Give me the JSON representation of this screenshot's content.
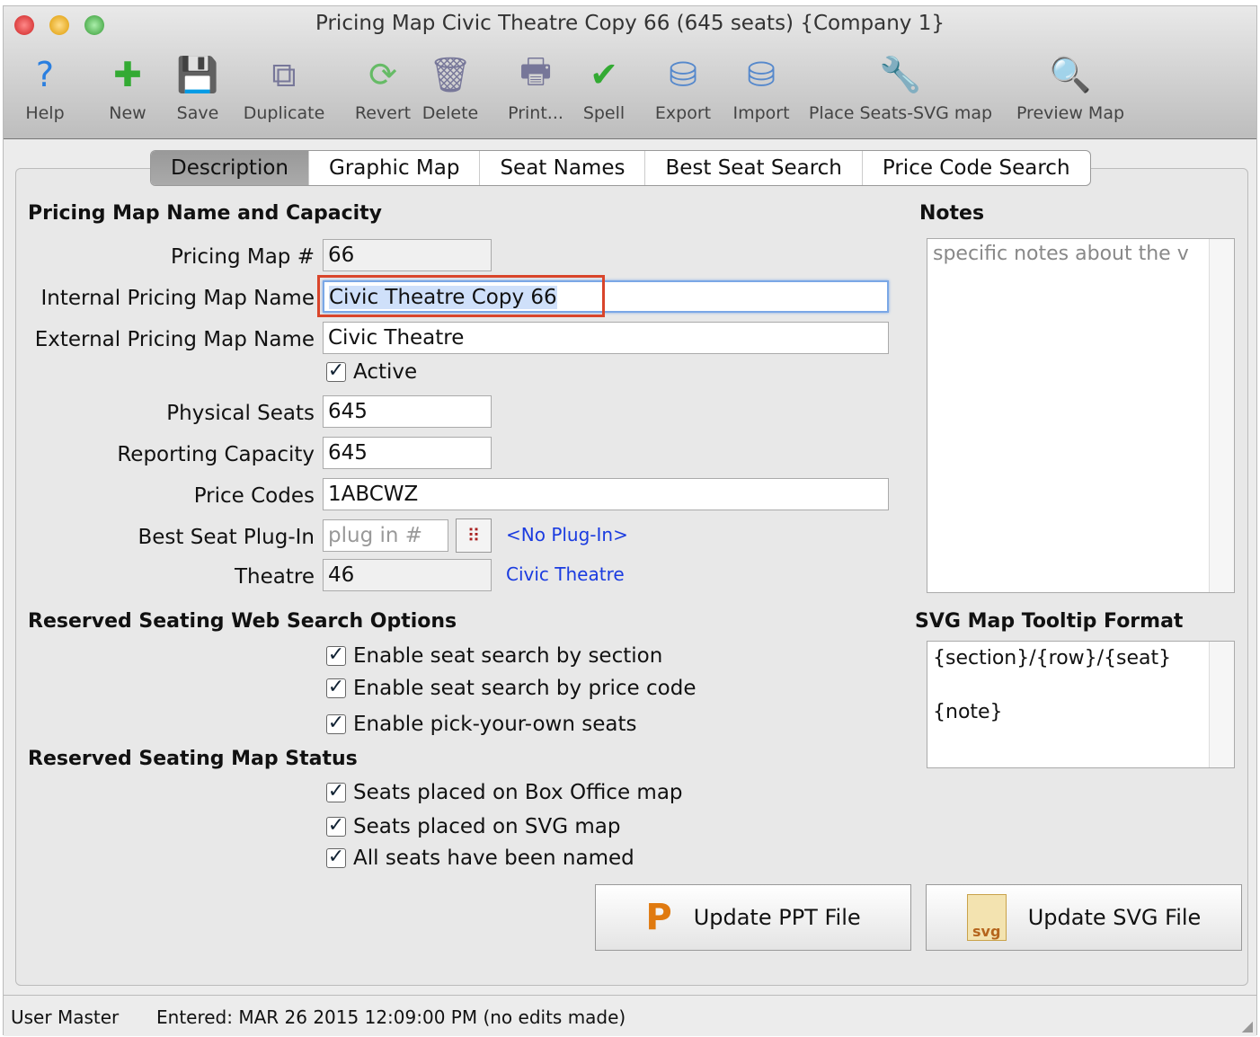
{
  "window": {
    "title": "Pricing Map Civic Theatre Copy 66 (645 seats) {Company 1}"
  },
  "toolbar": [
    {
      "label": "Help",
      "icon": "help-icon",
      "glyph": "?"
    },
    {
      "label": "New",
      "icon": "new-document-icon",
      "glyph": "✚"
    },
    {
      "label": "Save",
      "icon": "save-icon",
      "glyph": "💾"
    },
    {
      "label": "Duplicate",
      "icon": "duplicate-icon",
      "glyph": "⧉"
    },
    {
      "label": "Revert",
      "icon": "revert-icon",
      "glyph": "⟳"
    },
    {
      "label": "Delete",
      "icon": "trash-icon",
      "glyph": "🗑"
    },
    {
      "label": "Print...",
      "icon": "printer-icon",
      "glyph": "🖶"
    },
    {
      "label": "Spell",
      "icon": "spellcheck-icon",
      "glyph": "✔"
    },
    {
      "label": "Export",
      "icon": "database-export-icon",
      "glyph": "⛁"
    },
    {
      "label": "Import",
      "icon": "database-import-icon",
      "glyph": "⛁"
    },
    {
      "label": "Place Seats-SVG map",
      "icon": "wrench-icon",
      "glyph": "🔧"
    },
    {
      "label": "Preview Map",
      "icon": "magnifier-icon",
      "glyph": "🔍"
    }
  ],
  "tabs": [
    "Description",
    "Graphic Map",
    "Seat Names",
    "Best Seat Search",
    "Price Code Search"
  ],
  "section1": {
    "title": "Pricing Map Name and Capacity"
  },
  "fields": {
    "pricing_map_num": {
      "label": "Pricing Map #",
      "value": "66"
    },
    "internal_name": {
      "label": "Internal Pricing Map Name",
      "value": "Civic Theatre Copy 66"
    },
    "external_name": {
      "label": "External Pricing Map Name",
      "value": "Civic Theatre"
    },
    "active": {
      "label": "Active"
    },
    "physical_seats": {
      "label": "Physical Seats",
      "value": "645"
    },
    "reporting_capacity": {
      "label": "Reporting Capacity",
      "value": "645"
    },
    "price_codes": {
      "label": "Price Codes",
      "value": "1ABCWZ"
    },
    "best_seat_plugin": {
      "label": "Best Seat Plug-In",
      "placeholder": "plug in #",
      "link": "<No Plug-In>"
    },
    "theatre": {
      "label": "Theatre",
      "value": "46",
      "link": "Civic Theatre"
    }
  },
  "notes": {
    "title": "Notes",
    "value": "specific notes about the v"
  },
  "tooltip": {
    "title": "SVG Map Tooltip Format",
    "value": "{section}/{row}/{seat}\n\n{note}"
  },
  "section2": {
    "title": "Reserved Seating Web Search Options",
    "options": [
      "Enable seat search by section",
      "Enable seat search by price code",
      "Enable pick-your-own seats"
    ]
  },
  "section3": {
    "title": "Reserved Seating Map Status",
    "options": [
      "Seats placed on Box Office map",
      "Seats placed on SVG map",
      "All seats have been named"
    ]
  },
  "buttons": {
    "ppt": "Update PPT File",
    "svg": "Update SVG File",
    "svg_icon_text": "svg"
  },
  "status": {
    "user": "User Master",
    "entered": "Entered: MAR 26 2015 12:09:00 PM (no edits made)"
  },
  "colors": {
    "focus_highlight": "#d9452b",
    "link": "#1a3be0"
  }
}
